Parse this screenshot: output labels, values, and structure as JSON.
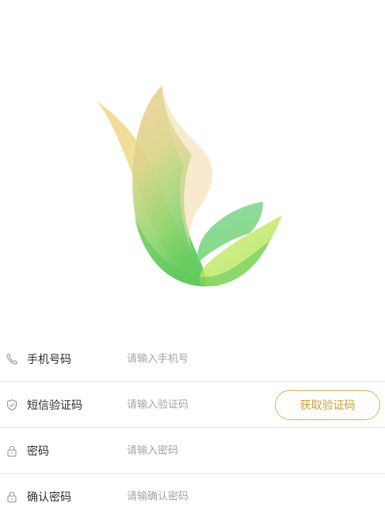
{
  "brand": {
    "logo_colors": [
      "#f2d67e",
      "#f0d494",
      "#7fd86a",
      "#c8ec5c",
      "#5cc85a"
    ]
  },
  "form": {
    "phone": {
      "label": "手机号码",
      "placeholder": "请输入手机号",
      "icon": "phone-icon"
    },
    "sms": {
      "label": "短信验证码",
      "placeholder": "请输入验证码",
      "icon": "shield-icon",
      "button_label": "获取验证码"
    },
    "password": {
      "label": "密码",
      "placeholder": "请输入密码",
      "icon": "lock-icon"
    },
    "confirm": {
      "label": "确认密码",
      "placeholder": "请输确认密码",
      "icon": "lock-icon"
    }
  },
  "colors": {
    "accent": "#c9a33b",
    "accent_border": "#d9b75a",
    "placeholder": "#a6a6a6",
    "divider": "#e6e6e6"
  }
}
